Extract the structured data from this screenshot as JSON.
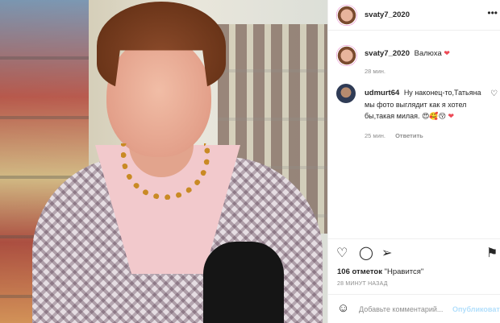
{
  "post": {
    "author": "svaty7_2020"
  },
  "caption": {
    "username": "svaty7_2020",
    "text": "Валюха",
    "heart": "❤",
    "time": "28 мин."
  },
  "comment": {
    "username": "udmurt64",
    "text": "Ну наконец-то,Татьяна мы фото выглядит как я хотел бы,такая милая.",
    "emojis": "😍🥰😚",
    "heart": "❤",
    "time": "25 мин.",
    "reply_label": "Ответить"
  },
  "actions": {
    "like_icon": "heart-outline-icon",
    "comment_icon": "comment-icon",
    "share_icon": "share-icon",
    "save_icon": "bookmark-icon"
  },
  "likes": {
    "count": "106 отметок",
    "label": "\"Нравится\""
  },
  "posted": "28 МИНУТ НАЗАД",
  "add_comment": {
    "placeholder": "Добавьте комментарий...",
    "publish_label": "Опубликовать"
  },
  "colors": {
    "accent": "#0095f6",
    "publish_disabled": "#b2dffc",
    "heart": "#ed4956",
    "muted": "#8e8e8e"
  }
}
